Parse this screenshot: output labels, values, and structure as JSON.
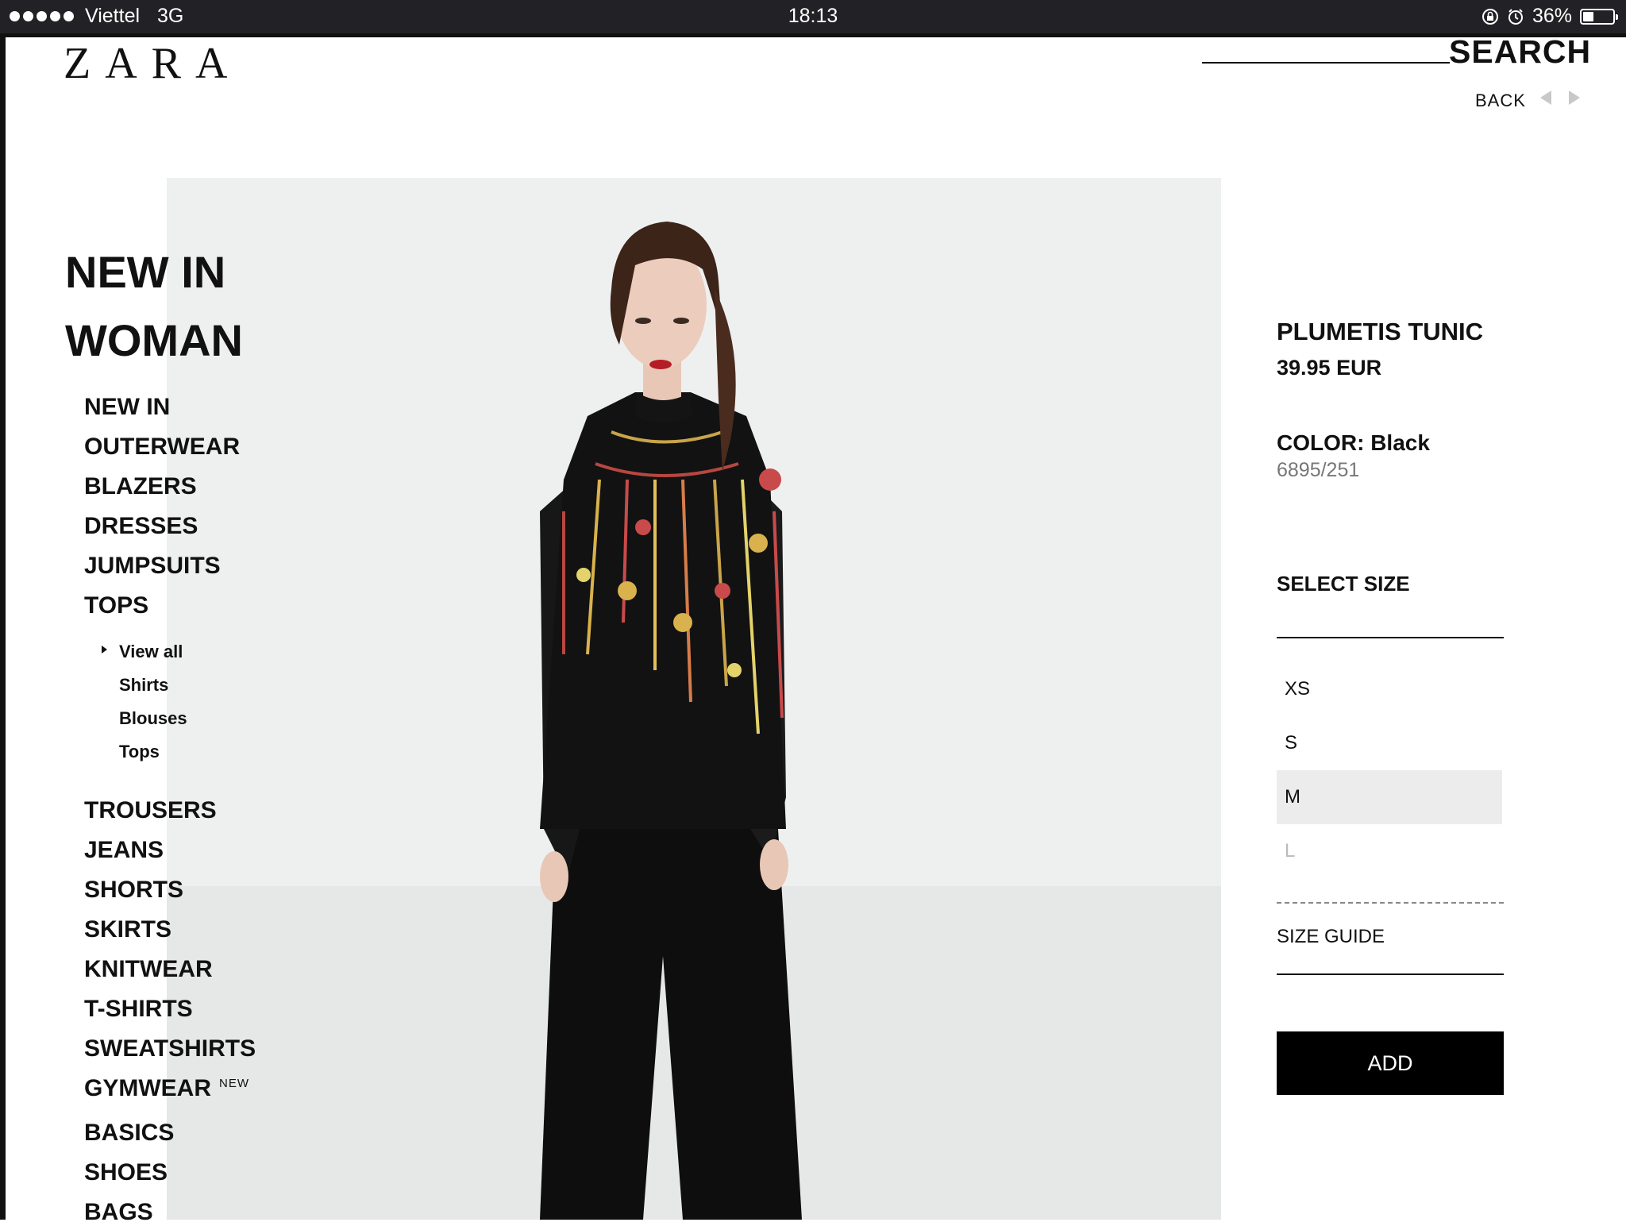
{
  "status_bar": {
    "carrier": "Viettel",
    "network": "3G",
    "time": "18:13",
    "battery": "36%",
    "battery_level": 0.36
  },
  "header": {
    "logo": "ZARA",
    "search_label": "SEARCH",
    "back_label": "BACK"
  },
  "nav": {
    "title_line1": "NEW IN",
    "title_line2": "WOMAN",
    "categories": [
      "NEW IN",
      "OUTERWEAR",
      "BLAZERS",
      "DRESSES",
      "JUMPSUITS",
      "TOPS"
    ],
    "tops_sub": [
      "View all",
      "Shirts",
      "Blouses",
      "Tops"
    ],
    "categories_more": [
      "TROUSERS",
      "JEANS",
      "SHORTS",
      "SKIRTS",
      "KNITWEAR",
      "T-SHIRTS",
      "SWEATSHIRTS",
      "GYMWEAR",
      "BASICS",
      "SHOES",
      "BAGS"
    ],
    "gymwear_badge": "NEW"
  },
  "product": {
    "name": "PLUMETIS TUNIC",
    "price": "39.95 EUR",
    "color": "COLOR: Black",
    "reference": "6895/251",
    "select_size_label": "SELECT SIZE",
    "sizes": [
      {
        "label": "XS",
        "state": "available"
      },
      {
        "label": "S",
        "state": "available"
      },
      {
        "label": "M",
        "state": "selected"
      },
      {
        "label": "L",
        "state": "unavailable"
      }
    ],
    "size_guide_label": "SIZE GUIDE",
    "add_label": "ADD"
  }
}
